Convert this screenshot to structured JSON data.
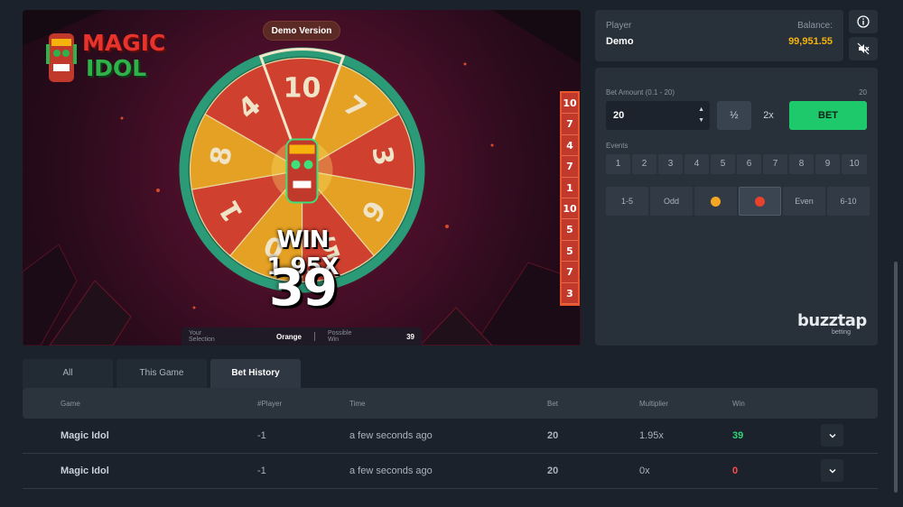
{
  "game": {
    "logo": {
      "line1": "MAGIC",
      "line2": "IDOL"
    },
    "demo_label": "Demo Version",
    "wheel": {
      "segments": [
        "10",
        "7",
        "3",
        "6",
        "5",
        "0",
        "1",
        "8",
        "4"
      ],
      "colors": {
        "red": "#d0402f",
        "orange": "#e5a123",
        "rim": "#2b9b77"
      }
    },
    "result": {
      "win_text": "WIN 1.95X",
      "number": "39"
    },
    "history": [
      "10",
      "7",
      "4",
      "7",
      "1",
      "10",
      "5",
      "5",
      "7",
      "3"
    ],
    "selection": {
      "your_label": "Your Selection",
      "your_value": "Orange",
      "possible_label": "Possible Win",
      "possible_value": "39"
    }
  },
  "player": {
    "label": "Player",
    "name": "Demo",
    "balance_label": "Balance:",
    "balance": "99,951.55"
  },
  "icons": {
    "info": "info-icon",
    "sound": "sound-off-icon"
  },
  "bet": {
    "amount_label": "Bet Amount (0.1 - 20)",
    "max_value": "20",
    "amount": "20",
    "half_label": "½",
    "double_label": "2x",
    "bet_label": "BET",
    "events_label": "Events",
    "events": [
      "1",
      "2",
      "3",
      "4",
      "5",
      "6",
      "7",
      "8",
      "9",
      "10"
    ],
    "options": {
      "range_low": "1-5",
      "odd": "Odd",
      "orange_color": "#f5a623",
      "red_color": "#e8412c",
      "even": "Even",
      "range_high": "6-10"
    }
  },
  "brand": {
    "name": "buzztap",
    "sub": "betting"
  },
  "tabs": [
    "All",
    "This Game",
    "Bet History"
  ],
  "table": {
    "headers": {
      "game": "Game",
      "player": "#Player",
      "time": "Time",
      "bet": "Bet",
      "multiplier": "Multiplier",
      "win": "Win"
    },
    "rows": [
      {
        "game": "Magic Idol",
        "player": "-1",
        "time": "a few seconds ago",
        "bet": "20",
        "multiplier": "1.95x",
        "win": "39"
      },
      {
        "game": "Magic Idol",
        "player": "-1",
        "time": "a few seconds ago",
        "bet": "20",
        "multiplier": "0x",
        "win": "0"
      }
    ]
  }
}
